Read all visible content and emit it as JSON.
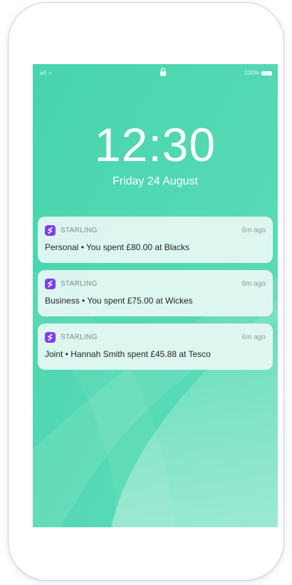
{
  "status_bar": {
    "signal": "all ≈",
    "battery": "100%"
  },
  "lock_screen": {
    "time": "12:30",
    "date": "Friday 24 August"
  },
  "notifications": [
    {
      "app": "STARLING",
      "time": "6m ago",
      "message": "Personal • You spent £80.00 at Blacks"
    },
    {
      "app": "STARLING",
      "time": "6m ago",
      "message": "Business • You spent £75.00 at Wickes"
    },
    {
      "app": "STARLING",
      "time": "6m ago",
      "message": "Joint • Hannah Smith spent £45.88 at Tesco"
    }
  ],
  "icons": {
    "app_icon": "starling-logo-icon",
    "lock": "lock-icon",
    "battery": "battery-icon"
  },
  "colors": {
    "wallpaper": "#4fd8b3",
    "app_icon": "#7b3ff2",
    "notification_bg": "#e8f8f4"
  }
}
